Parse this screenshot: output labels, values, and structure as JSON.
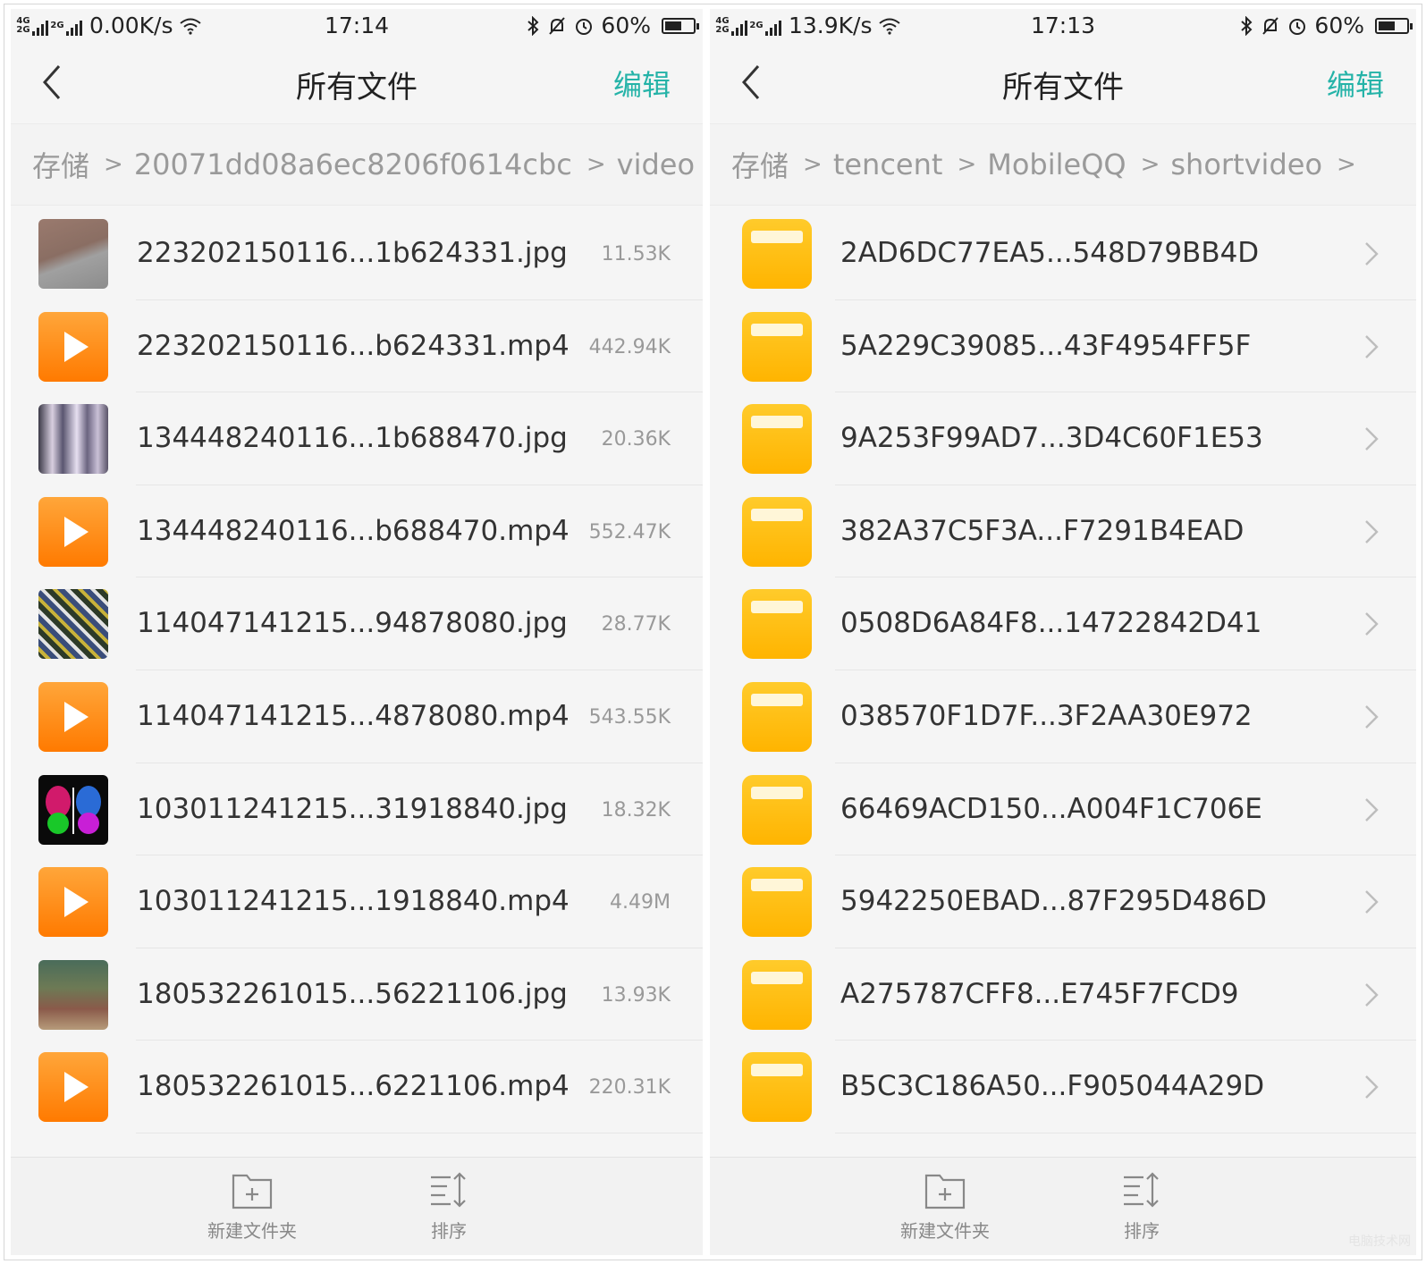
{
  "left_screen": {
    "status": {
      "net_label_top": "4G",
      "net_label_bottom": "2G",
      "net_label_2": "2G",
      "speed": "0.00K/s",
      "time": "17:14",
      "battery": "60%",
      "battery_level": 0.6
    },
    "nav": {
      "title": "所有文件",
      "edit_label": "编辑"
    },
    "breadcrumb": [
      "存储",
      "20071dd08a6ec8206f0614cbc",
      "video"
    ],
    "files": [
      {
        "name": "223202150116...1b624331.jpg",
        "size": "11.53K",
        "type": "jpg",
        "thumb": "photo1"
      },
      {
        "name": "223202150116...b624331.mp4",
        "size": "442.94K",
        "type": "mp4"
      },
      {
        "name": "134448240116...1b688470.jpg",
        "size": "20.36K",
        "type": "jpg",
        "thumb": "photo2"
      },
      {
        "name": "134448240116...b688470.mp4",
        "size": "552.47K",
        "type": "mp4"
      },
      {
        "name": "114047141215...94878080.jpg",
        "size": "28.77K",
        "type": "jpg",
        "thumb": "photo3"
      },
      {
        "name": "114047141215...4878080.mp4",
        "size": "543.55K",
        "type": "mp4"
      },
      {
        "name": "103011241215...31918840.jpg",
        "size": "18.32K",
        "type": "jpg",
        "thumb": "photo4"
      },
      {
        "name": "103011241215...1918840.mp4",
        "size": "4.49M",
        "type": "mp4"
      },
      {
        "name": "180532261015...56221106.jpg",
        "size": "13.93K",
        "type": "jpg",
        "thumb": "photo5"
      },
      {
        "name": "180532261015...6221106.mp4",
        "size": "220.31K",
        "type": "mp4"
      }
    ],
    "toolbar": {
      "new_folder": "新建文件夹",
      "sort": "排序"
    }
  },
  "right_screen": {
    "status": {
      "net_label_top": "4G",
      "net_label_bottom": "2G",
      "net_label_2": "2G",
      "speed": "13.9K/s",
      "time": "17:13",
      "battery": "60%",
      "battery_level": 0.6
    },
    "nav": {
      "title": "所有文件",
      "edit_label": "编辑"
    },
    "breadcrumb": [
      "存储",
      "tencent",
      "MobileQQ",
      "shortvideo"
    ],
    "folders": [
      "2AD6DC77EA5...548D79BB4D",
      "5A229C39085...43F4954FF5F",
      "9A253F99AD7...3D4C60F1E53",
      "382A37C5F3A...F7291B4EAD",
      "0508D6A84F8...14722842D41",
      "038570F1D7F...3F2AA30E972",
      "66469ACD150...A004F1C706E",
      "5942250EBAD...87F295D486D",
      "A275787CFF8...E745F7FCD9",
      "B5C3C186A50...F905044A29D"
    ],
    "toolbar": {
      "new_folder": "新建文件夹",
      "sort": "排序"
    }
  },
  "colors": {
    "accent": "#25b3a8",
    "video_orange": "#ff8a00",
    "folder_yellow": "#ffbf1a"
  },
  "icons": {
    "back": "chevron-left-icon",
    "play": "play-icon",
    "folder": "folder-icon",
    "chevron": "chevron-right-icon",
    "new_folder": "new-folder-icon",
    "sort": "sort-icon",
    "bluetooth": "bluetooth-icon",
    "mute": "bell-mute-icon",
    "alarm": "alarm-icon",
    "wifi": "wifi-icon",
    "battery": "battery-icon"
  },
  "watermark": "电脑技术网"
}
